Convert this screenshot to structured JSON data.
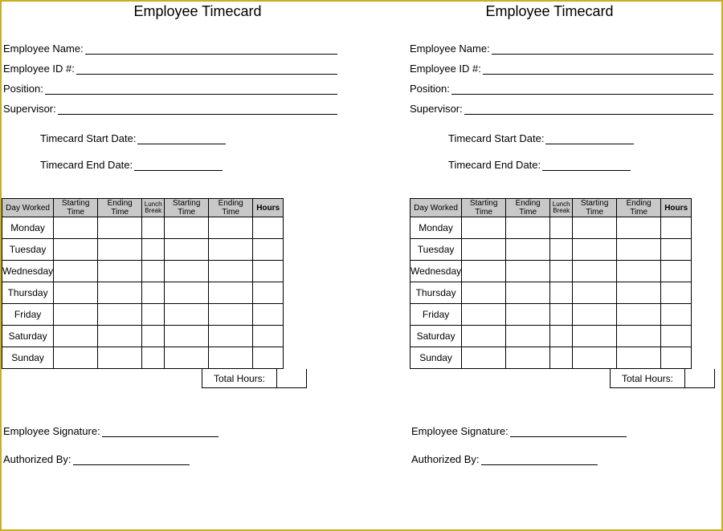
{
  "title": "Employee Timecard",
  "fields": {
    "name": "Employee Name:",
    "id": "Employee ID #:",
    "position": "Position:",
    "supervisor": "Supervisor:",
    "start_date": "Timecard Start Date:",
    "end_date": "Timecard End Date:",
    "signature": "Employee Signature:",
    "authorized": "Authorized By:"
  },
  "columns": {
    "day": "Day Worked",
    "start1": "Starting Time",
    "end1": "Ending Time",
    "lunch": "Lunch Break",
    "start2": "Starting Time",
    "end2": "Ending Time",
    "hours": "Hours"
  },
  "days": [
    "Monday",
    "Tuesday",
    "Wednesday",
    "Thursday",
    "Friday",
    "Saturday",
    "Sunday"
  ],
  "total_hours": "Total Hours:"
}
